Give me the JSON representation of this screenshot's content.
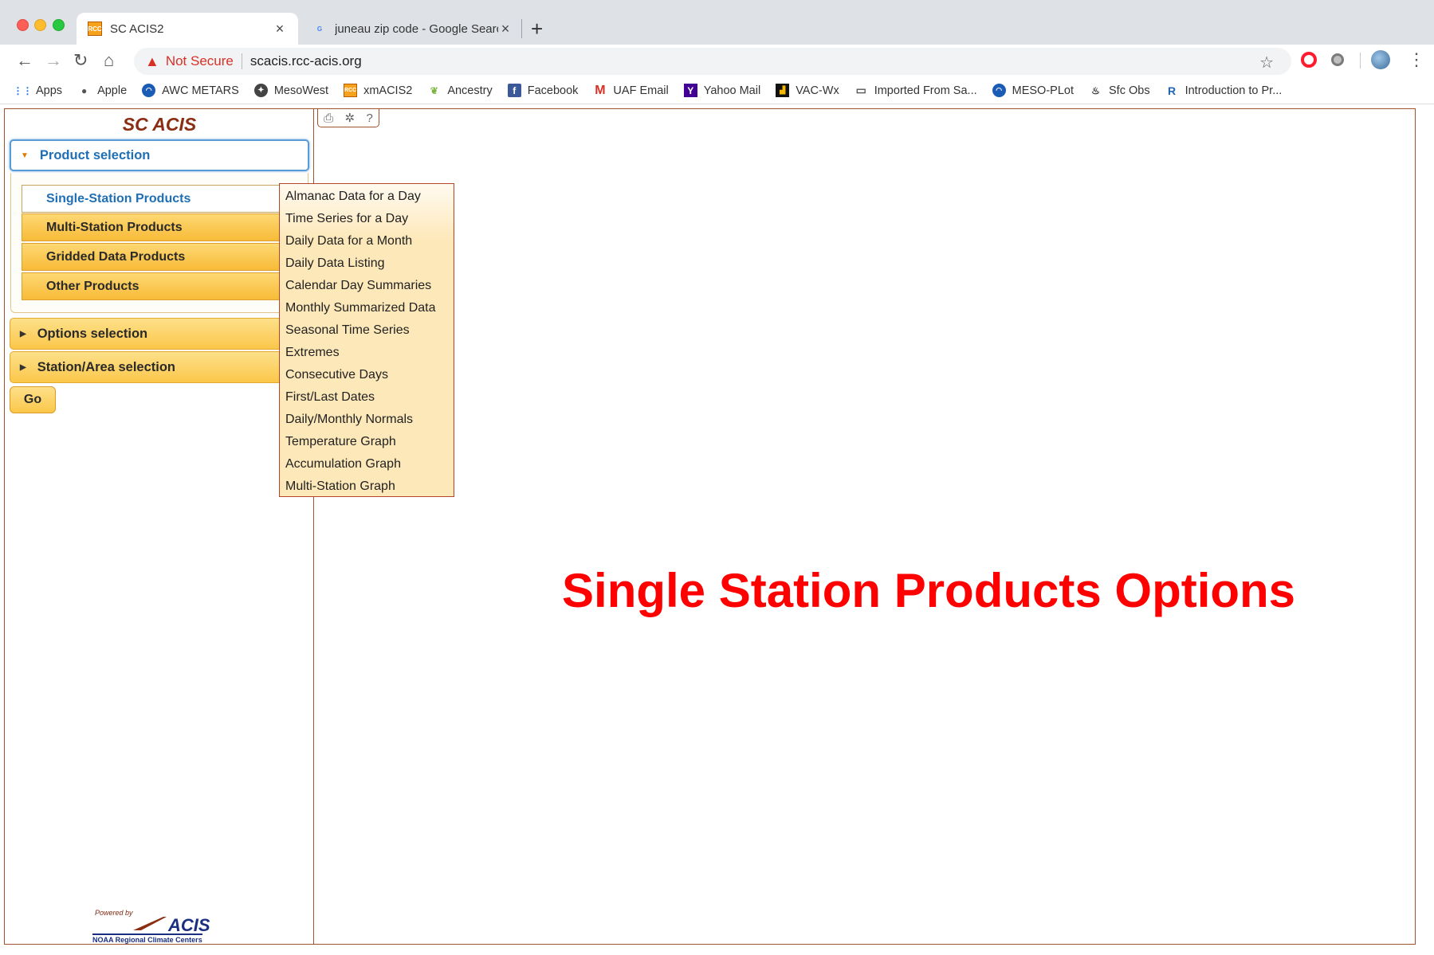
{
  "browser": {
    "tabs": [
      {
        "title": "SC ACIS2",
        "favicon": "rcc-icon",
        "active": true
      },
      {
        "title": "juneau zip code - Google Search",
        "favicon": "google-icon",
        "active": false
      }
    ],
    "address": {
      "security_label": "Not Secure",
      "url": "scacis.rcc-acis.org"
    },
    "bookmarks": [
      {
        "label": "Apps",
        "icon": "apps-grid-icon",
        "color": "#1a73e8"
      },
      {
        "label": "Apple",
        "icon": "apple-icon",
        "color": "#555555"
      },
      {
        "label": "AWC METARS",
        "icon": "noaa-icon",
        "color": "#1a5bb5"
      },
      {
        "label": "MesoWest",
        "icon": "globe-icon",
        "color": "#333333"
      },
      {
        "label": "xmACIS2",
        "icon": "rcc-icon",
        "color": "#f6a21d"
      },
      {
        "label": "Ancestry",
        "icon": "ancestry-leaf-icon",
        "color": "#7cb342"
      },
      {
        "label": "Facebook",
        "icon": "facebook-icon",
        "color": "#3b5998"
      },
      {
        "label": "UAF Email",
        "icon": "gmail-icon",
        "color": "#d93025"
      },
      {
        "label": "Yahoo Mail",
        "icon": "yahoo-icon",
        "color": "#410093"
      },
      {
        "label": "VAC-Wx",
        "icon": "wx-chart-icon",
        "color": "#111111"
      },
      {
        "label": "Imported From Sa...",
        "icon": "folder-icon",
        "color": "#555555"
      },
      {
        "label": "MESO-PLot",
        "icon": "noaa-icon",
        "color": "#1a5bb5"
      },
      {
        "label": "Sfc Obs",
        "icon": "flame-icon",
        "color": "#333333"
      },
      {
        "label": "Introduction to Pr...",
        "icon": "r-lang-icon",
        "color": "#2165b6"
      }
    ]
  },
  "sidebar": {
    "brand": "SC ACIS",
    "product_selection_label": "Product selection",
    "products": [
      {
        "label": "Single-Station Products",
        "active": true
      },
      {
        "label": "Multi-Station Products",
        "active": false
      },
      {
        "label": "Gridded Data Products",
        "active": false
      },
      {
        "label": "Other Products",
        "active": false
      }
    ],
    "options_selection_label": "Options selection",
    "station_area_selection_label": "Station/Area selection",
    "go_label": "Go",
    "footer": {
      "powered_by": "Powered by",
      "acis": "ACIS",
      "noaa": "NOAA Regional Climate Centers"
    }
  },
  "dropdown": {
    "items": [
      "Almanac Data for a Day",
      "Time Series for a Day",
      "Daily Data for a Month",
      "Daily Data Listing",
      "Calendar Day Summaries",
      "Monthly Summarized Data",
      "Seasonal Time Series",
      "Extremes",
      "Consecutive Days",
      "First/Last Dates",
      "Daily/Monthly Normals",
      "Temperature Graph",
      "Accumulation Graph",
      "Multi-Station Graph"
    ]
  },
  "content": {
    "overlay_title": "Single Station Products Options"
  },
  "colors": {
    "accent_blue": "#1f6fb5",
    "tab_gold": "#fbc74a",
    "border_brown": "#a0522d",
    "overlay_red": "#ff0000"
  }
}
